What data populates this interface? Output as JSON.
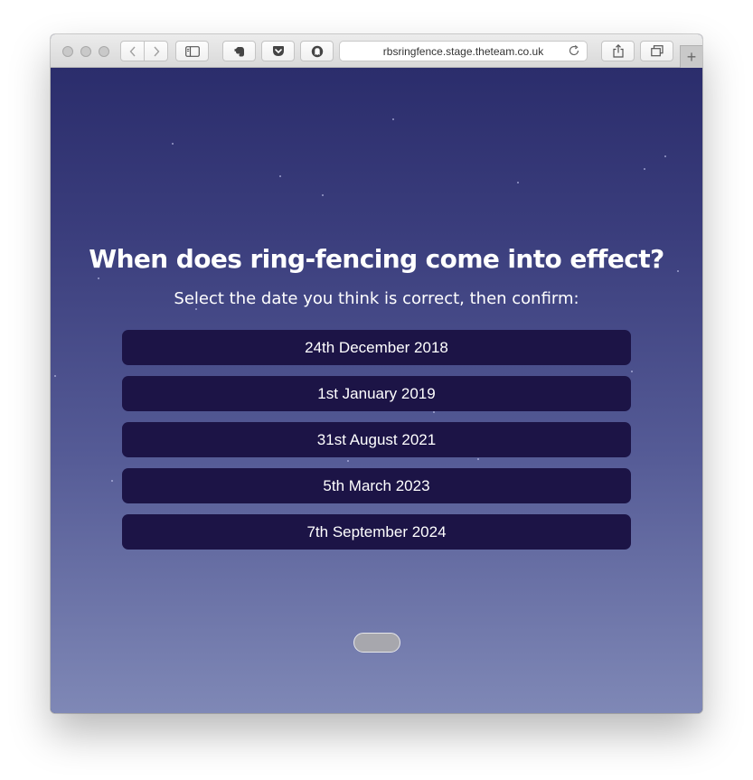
{
  "browser": {
    "url": "rbsringfence.stage.theteam.co.uk",
    "new_tab_label": "+"
  },
  "quiz": {
    "question": "When does ring-fencing come into effect?",
    "instruction": "Select the date you think is correct, then confirm:",
    "options": [
      "24th December 2018",
      "1st January 2019",
      "31st August 2021",
      "5th March 2023",
      "7th September 2024"
    ],
    "confirm_enabled": false
  },
  "colors": {
    "option_bg": "#1c1446",
    "background_top": "#2b2d6c",
    "background_bottom": "#7f88b6",
    "confirm_disabled": "#a7a7ad"
  }
}
